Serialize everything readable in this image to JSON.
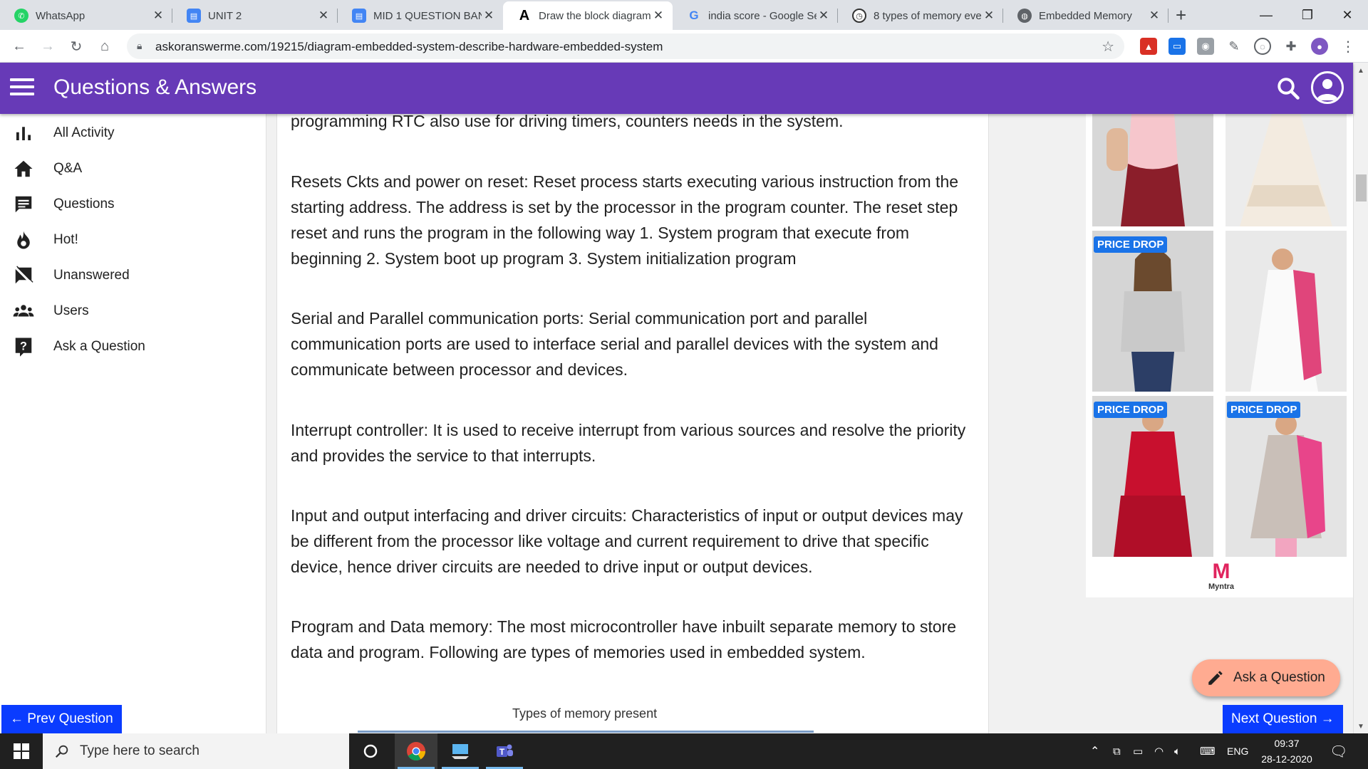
{
  "browser": {
    "tabs": [
      {
        "title": "WhatsApp",
        "icon": "whatsapp-icon",
        "color": "#25d366"
      },
      {
        "title": "UNIT 2",
        "icon": "google-docs-icon",
        "color": "#4285f4"
      },
      {
        "title": "MID 1 QUESTION BAN",
        "icon": "google-docs-icon",
        "color": "#4285f4"
      },
      {
        "title": "Draw the block diagram",
        "icon": "askoranswer-icon",
        "color": "#000000"
      },
      {
        "title": "india score - Google Se",
        "icon": "google-icon",
        "color": "#4285f4"
      },
      {
        "title": "8 types of memory eve",
        "icon": "site-icon",
        "color": "#333333"
      },
      {
        "title": "Embedded Memory",
        "icon": "globe-icon",
        "color": "#5f6368"
      }
    ],
    "active_tab_index": 3,
    "url": "askoranswerme.com/19215/diagram-embedded-system-describe-hardware-embedded-system"
  },
  "site": {
    "title": "Questions & Answers",
    "brand_color": "#673ab7"
  },
  "sidebar": {
    "items": [
      {
        "label": "All Activity",
        "icon": "bar-chart-icon"
      },
      {
        "label": "Q&A",
        "icon": "home-icon"
      },
      {
        "label": "Questions",
        "icon": "chat-icon"
      },
      {
        "label": "Hot!",
        "icon": "fire-icon"
      },
      {
        "label": "Unanswered",
        "icon": "no-comment-icon"
      },
      {
        "label": "Users",
        "icon": "users-icon"
      },
      {
        "label": "Ask a Question",
        "icon": "help-icon"
      }
    ]
  },
  "article": {
    "paragraphs": [
      "programming RTC also use for driving timers, counters needs in the system.",
      "Resets Ckts and power on reset: Reset process starts executing various instruction from the starting address. The address is set by the processor in the program counter. The reset step reset and runs the program in the following way 1. System program that execute from beginning 2. System boot up program 3. System initialization program",
      "Serial and Parallel communication ports: Serial communication port and parallel communication ports are used to interface serial and parallel devices with the system and communicate between processor and devices.",
      "Interrupt controller: It is used to receive interrupt from various sources and resolve the priority and provides the service to that interrupts.",
      "Input and output interfacing and driver circuits: Characteristics of input or output devices may be different from the processor like voltage and current requirement to drive that specific device, hence driver circuits are needed to drive input or output devices.",
      "Program and Data memory: The most microcontroller have inbuilt separate memory to store data and program. Following are types of memories used in embedded system."
    ],
    "figure_caption": "Types of memory present"
  },
  "ad": {
    "badge": "PRICE DROP",
    "brand": "Myntra",
    "brand_logo_letter": "M"
  },
  "actions": {
    "ask_question": "Ask a Question",
    "prev": "← Prev Question",
    "next": "Next Question →"
  },
  "taskbar": {
    "search_placeholder": "Type here to search",
    "language": "ENG",
    "time": "09:37",
    "date": "28-12-2020"
  }
}
